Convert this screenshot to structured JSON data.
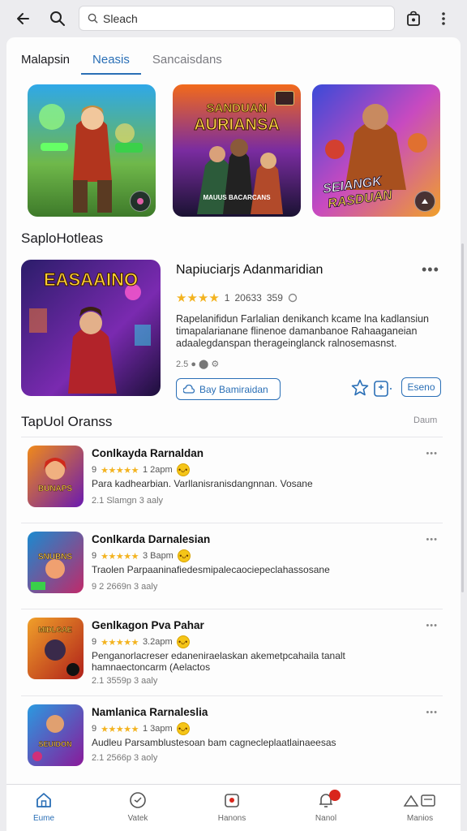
{
  "search": {
    "value": "Sleach"
  },
  "tabs": [
    {
      "label": "Malapsin"
    },
    {
      "label": "Neasis"
    },
    {
      "label": "Sancaisdans"
    }
  ],
  "banners": [
    {
      "caption": ""
    },
    {
      "caption_top": "SANDUAN",
      "caption_main": "AURIANSA",
      "caption_bottom": "MAUUS BACARCANS"
    },
    {
      "caption_top": "SEIANGK",
      "caption_main": "RASDUAN"
    }
  ],
  "featured": {
    "section_title": "SaploHotleas",
    "art_title": "EASAAINO",
    "title": "Napiuciarjs Adanmaridian",
    "rating_value": "1",
    "rating_count": "20633",
    "rating_extra": "359",
    "description": "Rapelanifidun Farlalian denikanch kcame lna kadlansiun timapalarianane flinenoe damanbanoe Rahaaganeian adaalegdanspan therageinglanck ralnosemasnst.",
    "meta": "2.5",
    "install_label": "Bay Bamiraidan",
    "small_button_label": "Eseno"
  },
  "list_section": {
    "title": "TapUol Oranss",
    "more_label": "Daum"
  },
  "list_items": [
    {
      "title": "Conlkayda Rarnaldan",
      "rating_value": "9",
      "rating_count": "1 2apm",
      "description": "Para kadhearbian. Varllanisranisdangnnan. Vosane",
      "meta": "2.1 Slamgn  3 aaly",
      "thumb_caption": "BUNAPS"
    },
    {
      "title": "Conlkarda Darnalesian",
      "rating_value": "9",
      "rating_count": "3 Bapm",
      "description": "Traolen Parpaaninafiedesmipalecaociepeclahassosane",
      "meta": "9 2 2669n  3 aaly",
      "thumb_caption": "SNUBNS"
    },
    {
      "title": "Genlkagon Pva Pahar",
      "rating_value": "9",
      "rating_count": "3.2apm",
      "description": "Penganorlacreser edaneniraelaskan akemetpcahaila tanalt hamnaectoncarm (Aelactos",
      "meta": "2.1 3559p  3 aaly",
      "thumb_caption": "MIDLGAE"
    },
    {
      "title": "Namlanica Rarnaleslia",
      "rating_value": "9",
      "rating_count": "1 3apm",
      "description": "Audleu Parsamblustesoan bam cagnecleplaatlainaeesas",
      "meta": "2.1 2566p  3 aoly",
      "thumb_caption": "SEUIDON"
    }
  ],
  "bottom_nav": [
    {
      "label": "Eume",
      "icon": "home-icon",
      "active": true
    },
    {
      "label": "Vatek",
      "icon": "clock-icon"
    },
    {
      "label": "Hanons",
      "icon": "store-icon"
    },
    {
      "label": "Nanol",
      "icon": "bell-icon",
      "badge": true
    },
    {
      "label": "Manios",
      "icon": "profile-icon"
    }
  ],
  "colors": {
    "accent": "#2a6fb6",
    "star": "#f3b320",
    "badge": "#d9261c"
  }
}
